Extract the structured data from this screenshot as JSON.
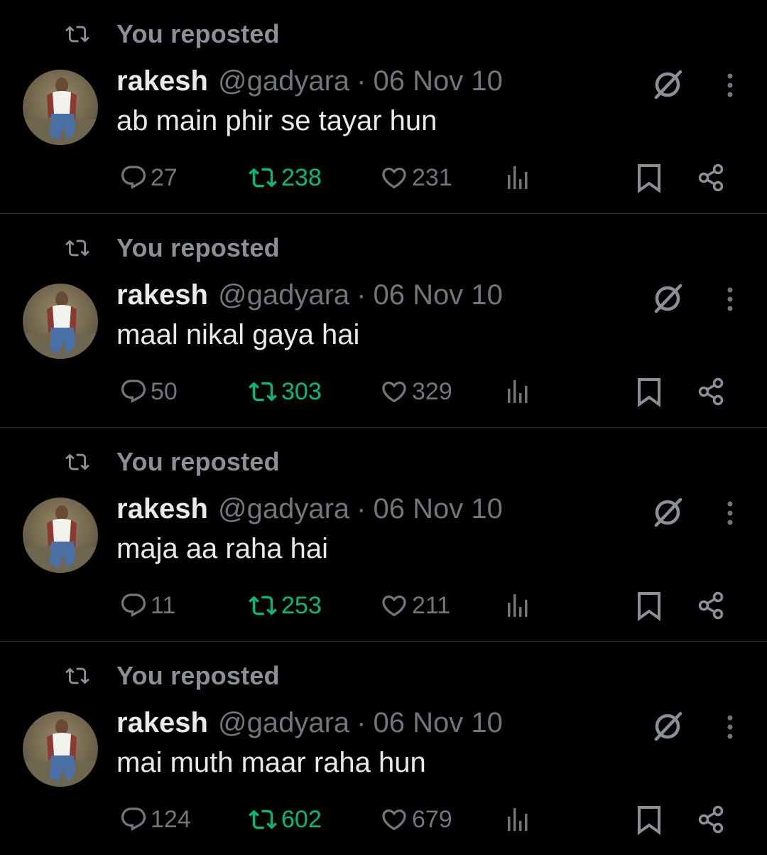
{
  "colors": {
    "background": "#000000",
    "text_primary": "#e7e9ea",
    "text_secondary": "#71767b",
    "repost_header": "#8b9096",
    "repost_active": "#00ba7c",
    "divider": "#2f3336"
  },
  "icons": {
    "repost": "repost-icon",
    "grok": "grok-icon",
    "more": "more-icon",
    "reply": "reply-icon",
    "like": "heart-icon",
    "views": "views-icon",
    "bookmark": "bookmark-icon",
    "share": "share-icon"
  },
  "tweets": [
    {
      "repost_label": "You reposted",
      "author_name": "rakesh",
      "handle": "@gadyara",
      "separator": "·",
      "date": "06 Nov 10",
      "text": "ab main phir se tayar hun",
      "replies": "27",
      "reposts": "238",
      "likes": "231",
      "reposted_by_me": true
    },
    {
      "repost_label": "You reposted",
      "author_name": "rakesh",
      "handle": "@gadyara",
      "separator": "·",
      "date": "06 Nov 10",
      "text": "maal nikal gaya hai",
      "replies": "50",
      "reposts": "303",
      "likes": "329",
      "reposted_by_me": true
    },
    {
      "repost_label": "You reposted",
      "author_name": "rakesh",
      "handle": "@gadyara",
      "separator": "·",
      "date": "06 Nov 10",
      "text": "maja aa raha hai",
      "replies": "11",
      "reposts": "253",
      "likes": "211",
      "reposted_by_me": true
    },
    {
      "repost_label": "You reposted",
      "author_name": "rakesh",
      "handle": "@gadyara",
      "separator": "·",
      "date": "06 Nov 10",
      "text": "mai muth maar raha hun",
      "replies": "124",
      "reposts": "602",
      "likes": "679",
      "reposted_by_me": true
    }
  ]
}
